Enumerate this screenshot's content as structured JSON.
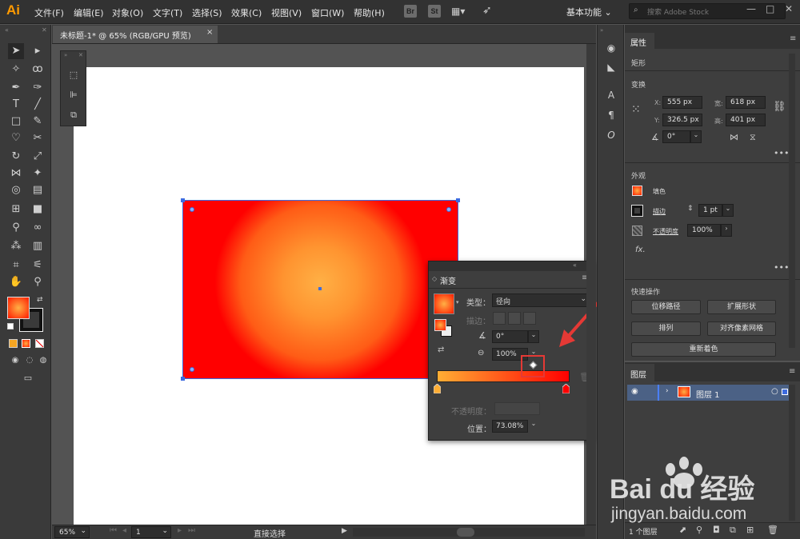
{
  "app": {
    "logo": "Ai"
  },
  "menubar": {
    "items": [
      "文件(F)",
      "编辑(E)",
      "对象(O)",
      "文字(T)",
      "选择(S)",
      "效果(C)",
      "视图(V)",
      "窗口(W)",
      "帮助(H)"
    ],
    "toolbar_icons": [
      "Br",
      "St"
    ],
    "workspace": "基本功能",
    "search_placeholder": "搜索 Adobe Stock"
  },
  "document": {
    "tab_title": "未标题-1* @ 65% (RGB/GPU 预览)",
    "close": "×"
  },
  "gradient_panel": {
    "title": "渐变",
    "type_label": "类型：",
    "type_value": "径向",
    "stroke_label": "描边：",
    "angle_value": "0°",
    "aspect_value": "100%",
    "opacity_label": "不透明度：",
    "location_label": "位置：",
    "location_value": "73.08%",
    "stops": [
      {
        "position": 0,
        "color": "#ffae34"
      },
      {
        "position": 100,
        "color": "#ff0000"
      }
    ],
    "midpoint_percent": 73.08
  },
  "properties": {
    "title": "属性",
    "selection_type": "矩形",
    "transform_title": "变换",
    "x_label": "X:",
    "x_value": "555 px",
    "y_label": "Y:",
    "y_value": "326.5 px",
    "w_label": "宽:",
    "w_value": "618 px",
    "h_label": "高:",
    "h_value": "401 px",
    "rotate_value": "0°",
    "appearance_title": "外观",
    "fill_label": "填色",
    "stroke_label": "描边",
    "stroke_weight": "1 pt",
    "opacity_label": "不透明度",
    "opacity_value": "100%",
    "fx_label": "fx.",
    "quick_title": "快速操作",
    "quick_buttons": [
      "位移路径",
      "扩展形状",
      "排列",
      "对齐像素网格",
      "重新着色"
    ]
  },
  "layers": {
    "title": "图层",
    "layer_name": "图层 1",
    "footer_count": "1 个图层"
  },
  "status": {
    "zoom": "65%",
    "artboard": "1",
    "tool_name": "直接选择"
  },
  "watermark": {
    "brand": "Bai du 经验",
    "url": "jingyan.baidu.com"
  },
  "colors": {
    "accent_orange": "#ff9a00",
    "highlight_red": "#e53935",
    "selection_blue": "#3d6be0",
    "gradient_start": "#ffb045",
    "gradient_end": "#ff0000"
  }
}
